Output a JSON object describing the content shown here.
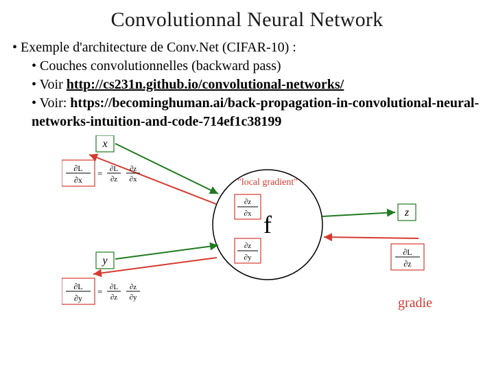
{
  "title": "Convolutionnal Neural Network",
  "bullets": {
    "b1": "Exemple d'architecture de Conv.Net  (CIFAR-10) :",
    "b2": "Couches convolutionnelles (backward pass)",
    "b3_prefix": "Voir ",
    "b3_link": "http://cs231n.github.io/convolutional-networks/",
    "b4_prefix": "Voir: ",
    "b4_link": "https://becominghuman.ai/back-propagation-in-convolutional-neural-networks-intuition-and-code-714ef1c38199"
  },
  "diagram": {
    "x": "x",
    "y": "y",
    "z": "z",
    "f": "f",
    "local_gradient": "\"local gradient\"",
    "grad_label": "gradients",
    "dL_dx_lhs": "∂L/∂x",
    "dL_dx_rhs": "= (∂L/∂z)(∂z/∂x)",
    "dL_dy_lhs": "∂L/∂y",
    "dL_dy_rhs": "= (∂L/∂z)(∂z/∂y)",
    "dz_dx": "∂z/∂x",
    "dz_dy": "∂z/∂y",
    "dL_dz": "∂L/∂z"
  }
}
